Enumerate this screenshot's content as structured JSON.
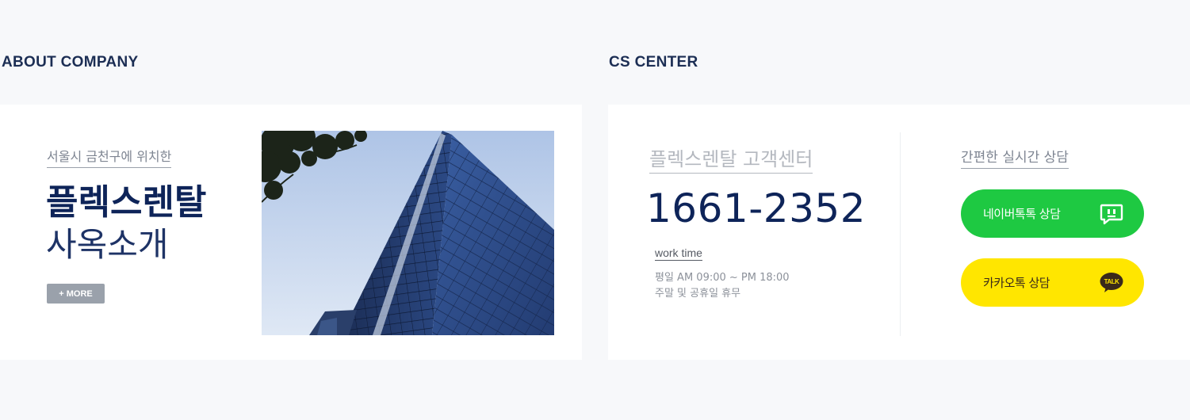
{
  "about": {
    "section_title": "ABOUT COMPANY",
    "subtitle": "서울시 금천구에 위치한",
    "title_line1": "플렉스렌탈",
    "title_line2": "사옥소개",
    "more_label": "+ MORE",
    "photo_icon": "building-photo"
  },
  "cs": {
    "section_title": "CS CENTER",
    "subtitle": "플렉스렌탈 고객센터",
    "phone": "1661-2352",
    "work_label": "work time",
    "work_weekday": "평일 AM 09:00 ~ PM 18:00",
    "work_weekend": "주말 및 공휴일 휴무"
  },
  "chat": {
    "subtitle": "간편한 실시간 상담",
    "naver_label": "네이버톡톡 상담",
    "naver_icon": "naver-talk-icon",
    "kakao_label": "카카오톡 상담",
    "kakao_icon": "kakao-talk-icon",
    "kakao_icon_text": "TALK"
  },
  "colors": {
    "background": "#f7f8fa",
    "navy": "#0e2459",
    "naver_green": "#1ec942",
    "kakao_yellow": "#ffe600"
  }
}
